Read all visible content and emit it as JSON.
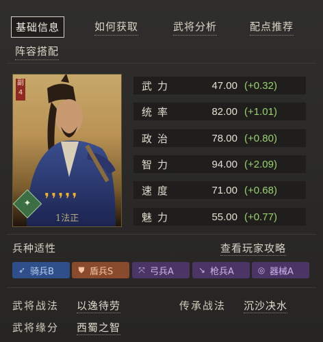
{
  "tabs": [
    {
      "label": "基础信息"
    },
    {
      "label": "如何获取"
    },
    {
      "label": "武将分析"
    },
    {
      "label": "配点推荐"
    },
    {
      "label": "阵容搭配"
    }
  ],
  "hero": {
    "badge": "副\n4",
    "cost_icon": "cost-badge",
    "stars": 5,
    "name": "1法正"
  },
  "stats": [
    {
      "name": "武力",
      "value": "47.00",
      "bonus": "(+0.32)"
    },
    {
      "name": "统率",
      "value": "82.00",
      "bonus": "(+1.01)"
    },
    {
      "name": "政治",
      "value": "78.00",
      "bonus": "(+0.80)"
    },
    {
      "name": "智力",
      "value": "94.00",
      "bonus": "(+2.09)"
    },
    {
      "name": "速度",
      "value": "71.00",
      "bonus": "(+0.68)"
    },
    {
      "name": "魅力",
      "value": "55.00",
      "bonus": "(+0.77)"
    }
  ],
  "troops": {
    "title": "兵种适性",
    "guide_link": "查看玩家攻略",
    "chips": [
      {
        "icon": "cavalry-icon",
        "label": "骑兵B",
        "bg": "#2e4f8a",
        "fg": "#b9cef0"
      },
      {
        "icon": "shield-icon",
        "label": "盾兵S",
        "bg": "#8a4a2e",
        "fg": "#f3c79f"
      },
      {
        "icon": "bow-icon",
        "label": "弓兵A",
        "bg": "#4b3566",
        "fg": "#cdb5ec"
      },
      {
        "icon": "spear-icon",
        "label": "枪兵A",
        "bg": "#4b3566",
        "fg": "#cdb5ec"
      },
      {
        "icon": "siege-icon",
        "label": "器械A",
        "bg": "#4b3566",
        "fg": "#cdb5ec"
      }
    ]
  },
  "skills": {
    "own_label": "武将战法",
    "own_value": "以逸待劳",
    "inherit_label": "传承战法",
    "inherit_value": "沉沙决水",
    "fate_label": "武将缘分",
    "fate_value": "西蜀之智"
  }
}
